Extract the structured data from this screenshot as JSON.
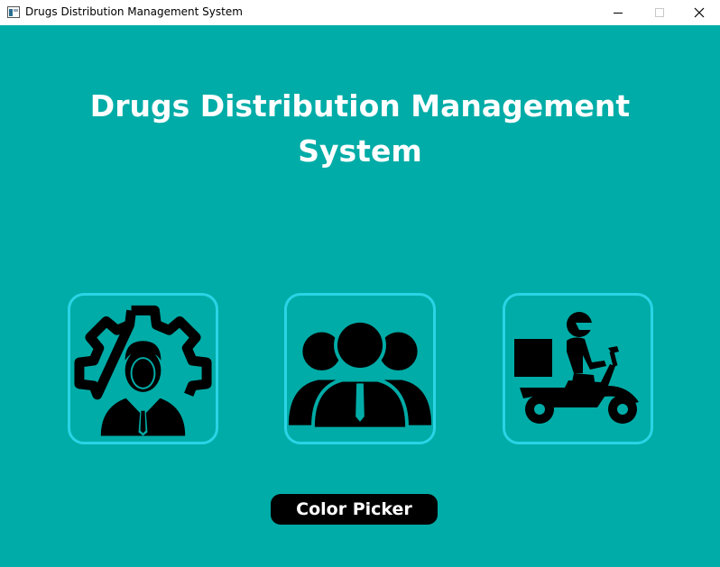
{
  "window": {
    "title": "Drugs Distribution Management System",
    "controls": [
      "minimize",
      "maximize",
      "close"
    ]
  },
  "main": {
    "title": "Drugs Distribution Management System",
    "background_color": "#00aca7",
    "cards": [
      {
        "id": "admin",
        "icon": "admin-gear-person-icon"
      },
      {
        "id": "customers",
        "icon": "people-group-icon"
      },
      {
        "id": "delivery",
        "icon": "delivery-scooter-icon"
      }
    ],
    "card_border_color": "#2ad4e6",
    "color_picker_label": "Color Picker"
  }
}
